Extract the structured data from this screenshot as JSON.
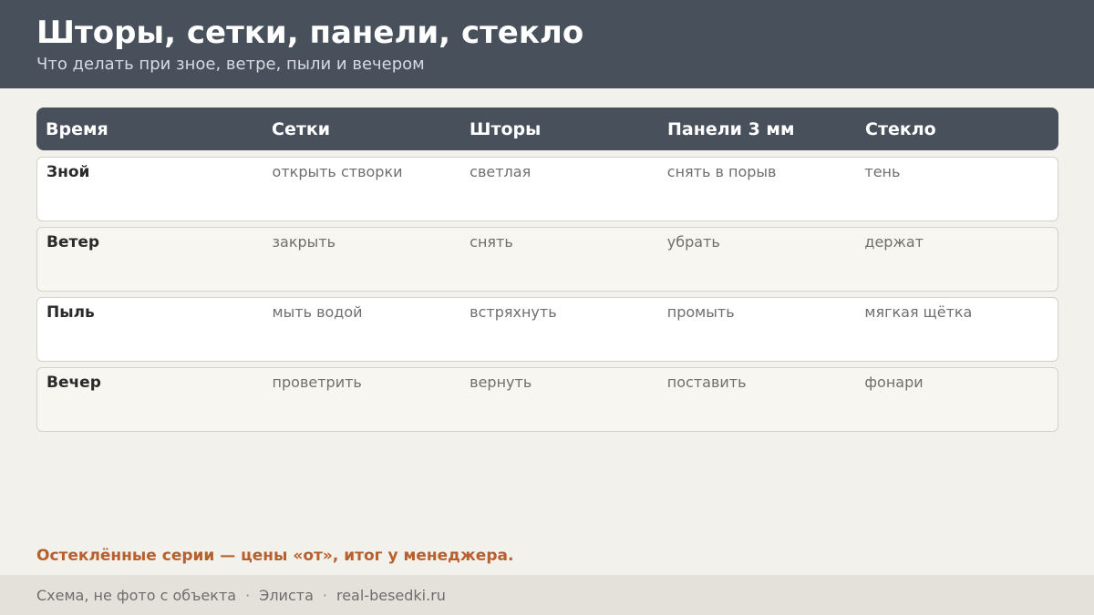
{
  "header": {
    "title": "Шторы, сетки, панели, стекло",
    "subtitle": "Что делать при зное, ветре, пыли и вечером"
  },
  "table": {
    "columns": [
      "Время",
      "Сетки",
      "Шторы",
      "Панели 3 мм",
      "Стекло"
    ],
    "rows": [
      [
        "Зной",
        "открыть створки",
        "светлая",
        "снять в порыв",
        "тень"
      ],
      [
        "Ветер",
        "закрыть",
        "снять",
        "убрать",
        "держат"
      ],
      [
        "Пыль",
        "мыть водой",
        "встряхнуть",
        "промыть",
        "мягкая щётка"
      ],
      [
        "Вечер",
        "проветрить",
        "вернуть",
        "поставить",
        "фонари"
      ]
    ]
  },
  "note": "Остеклённые серии — цены «от», итог у менеджера.",
  "footer": {
    "items": [
      "Схема, не фото с объекта",
      "Элиста",
      "real-besedki.ru"
    ],
    "separator": "·"
  },
  "colors": {
    "header_bg": "#48505c",
    "accent": "#b8602d",
    "page_bg": "#f3f1ec"
  }
}
